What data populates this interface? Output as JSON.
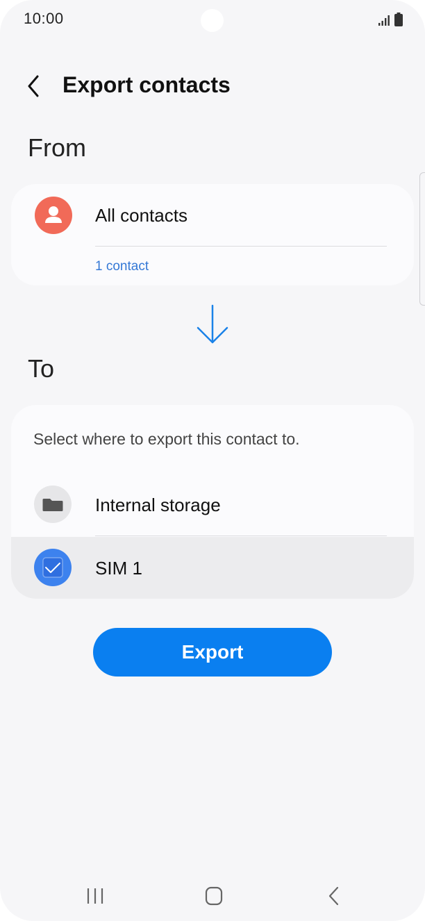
{
  "status_bar": {
    "time": "10:00"
  },
  "header": {
    "title": "Export contacts"
  },
  "from": {
    "section_label": "From",
    "source_label": "All contacts",
    "count_text": "1 contact"
  },
  "to": {
    "section_label": "To",
    "description": "Select where to export this contact to.",
    "options": [
      {
        "label": "Internal storage",
        "icon": "folder-icon",
        "selected": false
      },
      {
        "label": "SIM 1",
        "icon": "sim-check-icon",
        "selected": true
      }
    ]
  },
  "actions": {
    "export_label": "Export"
  },
  "colors": {
    "accent": "#0a7ff0",
    "link": "#3478d6",
    "contact_avatar": "#f16a58",
    "sim_avatar": "#3d82ee",
    "background": "#f6f6f8"
  },
  "nav": {
    "recent": "recent-apps-icon",
    "home": "home-icon",
    "back": "back-icon"
  }
}
